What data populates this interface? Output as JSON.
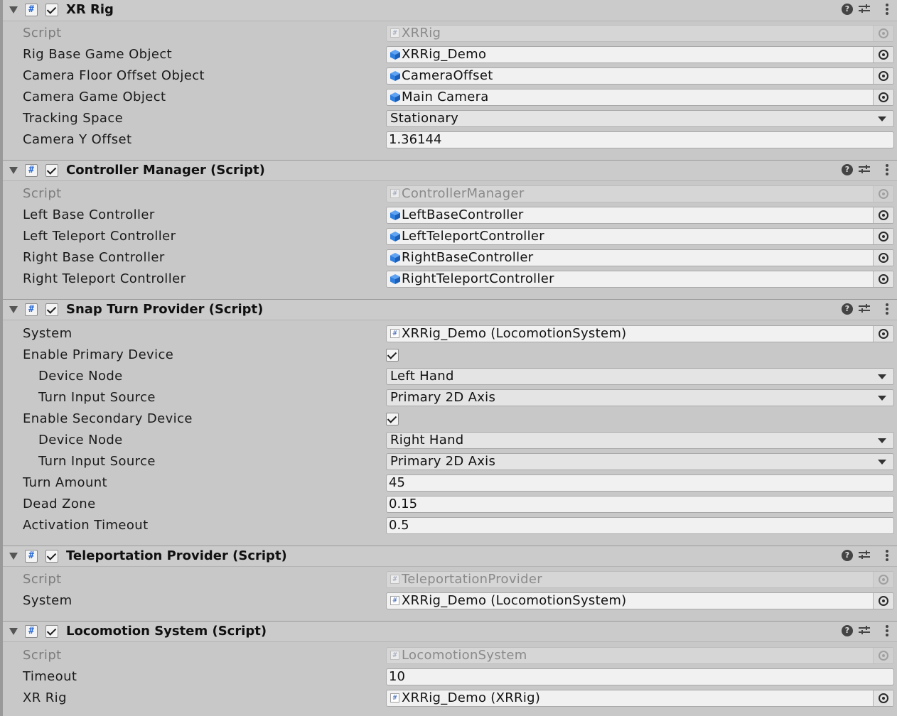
{
  "components": [
    {
      "title": "XR Rig",
      "props": [
        {
          "label": "Script",
          "type": "script",
          "value": "XRRig",
          "disabled": true
        },
        {
          "label": "Rig Base Game Object",
          "type": "object",
          "icon": "gameobject-cube-icon",
          "value": "XRRig_Demo"
        },
        {
          "label": "Camera Floor Offset Object",
          "type": "object",
          "icon": "gameobject-cube-icon",
          "value": "CameraOffset"
        },
        {
          "label": "Camera Game Object",
          "type": "object",
          "icon": "gameobject-cube-icon",
          "value": "Main Camera"
        },
        {
          "label": "Tracking Space",
          "type": "dropdown",
          "value": "Stationary"
        },
        {
          "label": "Camera Y Offset",
          "type": "number",
          "value": "1.36144"
        }
      ]
    },
    {
      "title": "Controller Manager (Script)",
      "props": [
        {
          "label": "Script",
          "type": "script",
          "value": "ControllerManager",
          "disabled": true
        },
        {
          "label": "Left Base Controller",
          "type": "object",
          "icon": "gameobject-cube-icon",
          "value": "LeftBaseController"
        },
        {
          "label": "Left Teleport Controller",
          "type": "object",
          "icon": "gameobject-cube-icon",
          "value": "LeftTeleportController"
        },
        {
          "label": "Right Base Controller",
          "type": "object",
          "icon": "gameobject-cube-icon",
          "value": "RightBaseController"
        },
        {
          "label": "Right Teleport Controller",
          "type": "object",
          "icon": "gameobject-cube-icon",
          "value": "RightTeleportController"
        }
      ]
    },
    {
      "title": "Snap Turn Provider (Script)",
      "props": [
        {
          "label": "System",
          "type": "script",
          "value": "XRRig_Demo (LocomotionSystem)"
        },
        {
          "label": "Enable Primary Device",
          "type": "checkbox",
          "checked": true
        },
        {
          "label": "Device Node",
          "type": "dropdown",
          "value": "Left Hand",
          "indent": true
        },
        {
          "label": "Turn Input Source",
          "type": "dropdown",
          "value": "Primary 2D Axis",
          "indent": true
        },
        {
          "label": "Enable Secondary Device",
          "type": "checkbox",
          "checked": true
        },
        {
          "label": "Device Node",
          "type": "dropdown",
          "value": "Right Hand",
          "indent": true
        },
        {
          "label": "Turn Input Source",
          "type": "dropdown",
          "value": "Primary 2D Axis",
          "indent": true
        },
        {
          "label": "Turn Amount",
          "type": "number",
          "value": "45"
        },
        {
          "label": "Dead Zone",
          "type": "number",
          "value": "0.15"
        },
        {
          "label": "Activation Timeout",
          "type": "number",
          "value": "0.5"
        }
      ]
    },
    {
      "title": "Teleportation Provider (Script)",
      "props": [
        {
          "label": "Script",
          "type": "script",
          "value": "TeleportationProvider",
          "disabled": true
        },
        {
          "label": "System",
          "type": "script",
          "value": "XRRig_Demo (LocomotionSystem)"
        }
      ]
    },
    {
      "title": "Locomotion System (Script)",
      "props": [
        {
          "label": "Script",
          "type": "script",
          "value": "LocomotionSystem",
          "disabled": true
        },
        {
          "label": "Timeout",
          "type": "number",
          "value": "10"
        },
        {
          "label": "XR Rig",
          "type": "script",
          "value": "XRRig_Demo (XRRig)"
        }
      ]
    }
  ],
  "colors": {
    "cube_blue": "#2f7fe0",
    "script_blue": "#2a6bd6"
  }
}
